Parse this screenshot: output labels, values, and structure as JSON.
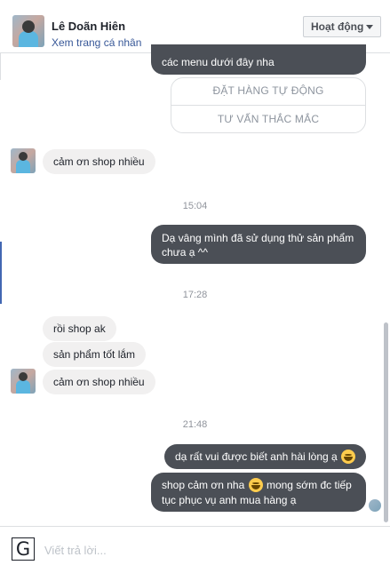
{
  "header": {
    "name": "Lê Doãn Hiên",
    "profile_link": "Xem trang cá nhân",
    "status_label": "Hoạt động"
  },
  "messages": {
    "top_partial": "các menu dưới đây nha",
    "quick_replies": [
      "ĐẶT HÀNG TỰ ĐỘNG",
      "TƯ VẤN THẮC MẮC"
    ],
    "thanks_1": "cảm ơn shop nhiều",
    "time_1": "15:04",
    "reply_1_line1": "Dạ vâng mình đã sử dụng thử sản phẩm",
    "reply_1_line2": "chưa ạ ^^",
    "time_2": "17:28",
    "in_1": "rồi shop ak",
    "in_2": "sản phẩm tốt lắm",
    "in_3": "cảm ơn shop nhiều",
    "time_3": "21:48",
    "reply_2": "dạ rất vui được biết anh hài lòng ạ",
    "reply_3_part1": "shop cảm ơn nha",
    "reply_3_part2": "mong sớm đc tiếp",
    "reply_3_line2": "tục phục vụ anh mua hàng ạ"
  },
  "composer": {
    "placeholder": "Viết trả lời...",
    "icon_glyph": "G"
  },
  "icons": [
    "avatar",
    "caret-down-icon",
    "smile-emoji-icon",
    "g-icon"
  ],
  "colors": {
    "accent": "#4267b2",
    "bubble_out": "#4b4f56",
    "bubble_in": "#f1f0f0",
    "link": "#385898"
  }
}
